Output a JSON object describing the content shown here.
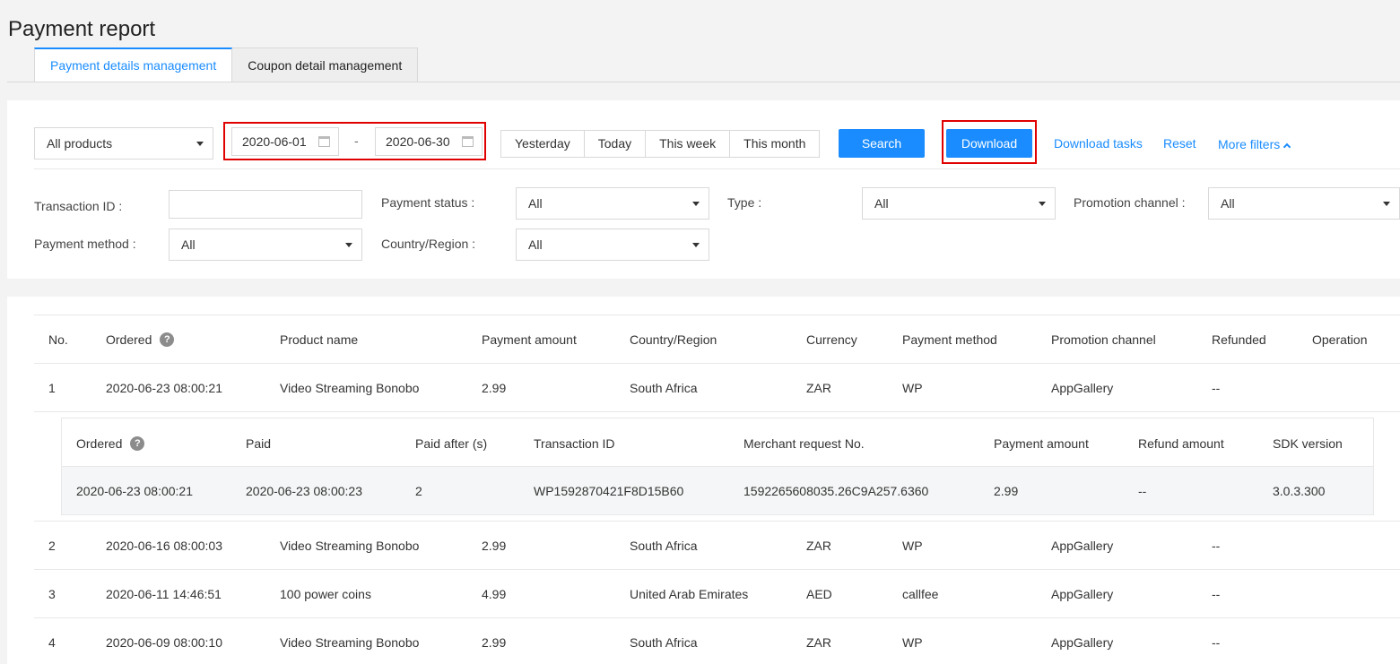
{
  "page": {
    "title": "Payment report"
  },
  "tabs": [
    {
      "label": "Payment details management",
      "active": true
    },
    {
      "label": "Coupon detail management",
      "active": false
    }
  ],
  "filters": {
    "product_select": "All products",
    "start_date": "2020-06-01",
    "date_separator": "-",
    "end_date": "2020-06-30",
    "quick_ranges": [
      "Yesterday",
      "Today",
      "This week",
      "This month"
    ],
    "search_label": "Search",
    "download_label": "Download",
    "download_tasks_label": "Download tasks",
    "reset_label": "Reset",
    "more_filters_label": "More filters",
    "fields": {
      "transaction_id": {
        "label": "Transaction ID :",
        "value": ""
      },
      "payment_status": {
        "label": "Payment status :",
        "value": "All"
      },
      "type": {
        "label": "Type :",
        "value": "All"
      },
      "promotion_channel": {
        "label": "Promotion channel :",
        "value": "All"
      },
      "payment_method": {
        "label": "Payment method :",
        "value": "All"
      },
      "country_region": {
        "label": "Country/Region :",
        "value": "All"
      }
    }
  },
  "table": {
    "columns": [
      "No.",
      "Ordered",
      "Product name",
      "Payment amount",
      "Country/Region",
      "Currency",
      "Payment method",
      "Promotion channel",
      "Refunded",
      "Operation"
    ],
    "help_icon": "?",
    "rows": [
      {
        "no": "1",
        "ordered": "2020-06-23 08:00:21",
        "product": "Video Streaming Bonobo",
        "amount": "2.99",
        "country": "South Africa",
        "currency": "ZAR",
        "method": "WP",
        "channel": "AppGallery",
        "refunded": "--"
      },
      {
        "no": "2",
        "ordered": "2020-06-16 08:00:03",
        "product": "Video Streaming Bonobo",
        "amount": "2.99",
        "country": "South Africa",
        "currency": "ZAR",
        "method": "WP",
        "channel": "AppGallery",
        "refunded": "--"
      },
      {
        "no": "3",
        "ordered": "2020-06-11 14:46:51",
        "product": "100 power coins",
        "amount": "4.99",
        "country": "United Arab Emirates",
        "currency": "AED",
        "method": "callfee",
        "channel": "AppGallery",
        "refunded": "--"
      },
      {
        "no": "4",
        "ordered": "2020-06-09 08:00:10",
        "product": "Video Streaming Bonobo",
        "amount": "2.99",
        "country": "South Africa",
        "currency": "ZAR",
        "method": "WP",
        "channel": "AppGallery",
        "refunded": "--"
      }
    ],
    "detail": {
      "columns": [
        "Ordered",
        "Paid",
        "Paid after (s)",
        "Transaction ID",
        "Merchant request No.",
        "Payment amount",
        "Refund amount",
        "SDK version"
      ],
      "row": {
        "ordered": "2020-06-23 08:00:21",
        "paid": "2020-06-23 08:00:23",
        "paid_after": "2",
        "transaction_id": "WP1592870421F8D15B60",
        "merchant_request_no": "1592265608035.26C9A257.6360",
        "payment_amount": "2.99",
        "refund_amount": "--",
        "sdk_version": "3.0.3.300"
      }
    }
  },
  "colors": {
    "accent": "#1a8cff",
    "highlight": "#e00000"
  }
}
